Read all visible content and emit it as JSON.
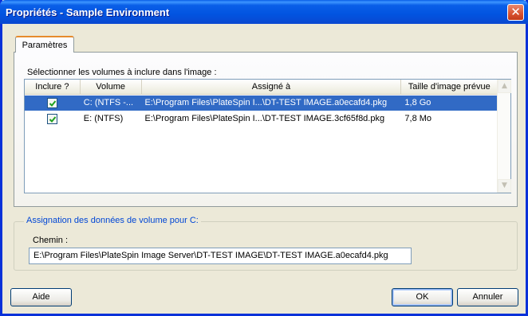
{
  "window": {
    "title": "Propriétés - Sample Environment",
    "close_icon": "close-icon"
  },
  "tab": {
    "label": "Paramètres"
  },
  "volumes": {
    "section_label": "Sélectionner les volumes à inclure dans l'image :",
    "columns": [
      "Inclure ?",
      "Volume",
      "Assigné à",
      "Taille d'image prévue"
    ],
    "rows": [
      {
        "include": true,
        "volume": "C: (NTFS -...",
        "assigned": "E:\\Program Files\\PlateSpin I...\\DT-TEST IMAGE.a0ecafd4.pkg",
        "size": "1,8 Go",
        "selected": true
      },
      {
        "include": true,
        "volume": "E: (NTFS)",
        "assigned": "E:\\Program Files\\PlateSpin I...\\DT-TEST IMAGE.3cf65f8d.pkg",
        "size": "7,8 Mo",
        "selected": false
      }
    ]
  },
  "assignment": {
    "group_label": "Assignation des données de volume pour C:",
    "path_label": "Chemin :",
    "path_value": "E:\\Program Files\\PlateSpin Image Server\\DT-TEST IMAGE\\DT-TEST IMAGE.a0ecafd4.pkg"
  },
  "buttons": {
    "help": "Aide",
    "ok": "OK",
    "cancel": "Annuler"
  },
  "colors": {
    "titlebar": "#0a5fe8",
    "selection": "#316ac5",
    "group_label": "#0046d5"
  }
}
